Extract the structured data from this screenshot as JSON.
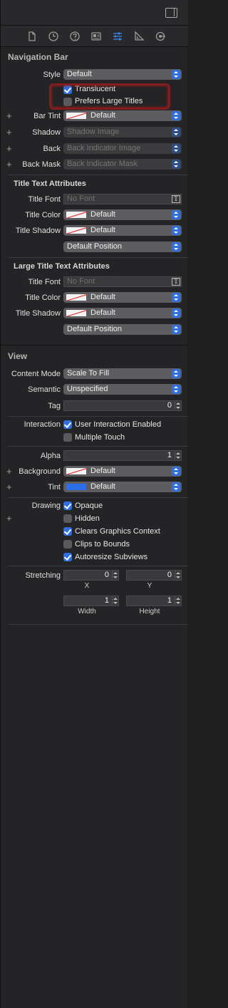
{
  "tabs": [
    {
      "name": "file-inspector-icon"
    },
    {
      "name": "history-inspector-icon"
    },
    {
      "name": "help-inspector-icon"
    },
    {
      "name": "identity-inspector-icon"
    },
    {
      "name": "attributes-inspector-icon",
      "active": true
    },
    {
      "name": "size-inspector-icon"
    },
    {
      "name": "connections-inspector-icon"
    }
  ],
  "nav_bar": {
    "title": "Navigation Bar",
    "style_label": "Style",
    "style_value": "Default",
    "translucent_label": "Translucent",
    "translucent_checked": true,
    "prefers_large_label": "Prefers Large Titles",
    "prefers_large_checked": false,
    "bar_tint_label": "Bar Tint",
    "bar_tint_value": "Default",
    "shadow_label": "Shadow",
    "shadow_placeholder": "Shadow Image",
    "back_label": "Back",
    "back_placeholder": "Back Indicator Image",
    "back_mask_label": "Back Mask",
    "back_mask_placeholder": "Back Indicator Mask"
  },
  "title_text": {
    "title": "Title Text Attributes",
    "font_label": "Title Font",
    "font_placeholder": "No Font",
    "color_label": "Title Color",
    "color_value": "Default",
    "shadow_label": "Title Shadow",
    "shadow_value": "Default",
    "position_value": "Default Position"
  },
  "large_title_text": {
    "title": "Large Title Text Attributes",
    "font_label": "Title Font",
    "font_placeholder": "No Font",
    "color_label": "Title Color",
    "color_value": "Default",
    "shadow_label": "Title Shadow",
    "shadow_value": "Default",
    "position_value": "Default Position"
  },
  "view": {
    "title": "View",
    "content_mode_label": "Content Mode",
    "content_mode_value": "Scale To Fill",
    "semantic_label": "Semantic",
    "semantic_value": "Unspecified",
    "tag_label": "Tag",
    "tag_value": "0",
    "interaction_label": "Interaction",
    "user_interaction_label": "User Interaction Enabled",
    "user_interaction_checked": true,
    "multiple_touch_label": "Multiple Touch",
    "multiple_touch_checked": false,
    "alpha_label": "Alpha",
    "alpha_value": "1",
    "background_label": "Background",
    "background_value": "Default",
    "tint_label": "Tint",
    "tint_value": "Default",
    "tint_color": "#2b6ee8",
    "drawing_label": "Drawing",
    "opaque_label": "Opaque",
    "opaque_checked": true,
    "hidden_label": "Hidden",
    "hidden_checked": false,
    "clears_label": "Clears Graphics Context",
    "clears_checked": true,
    "clips_label": "Clips to Bounds",
    "clips_checked": false,
    "autoresize_label": "Autoresize Subviews",
    "autoresize_checked": true,
    "stretching_label": "Stretching",
    "x_value": "0",
    "y_value": "0",
    "width_value": "1",
    "height_value": "1",
    "x_caption": "X",
    "y_caption": "Y",
    "width_caption": "Width",
    "height_caption": "Height"
  },
  "plus_symbol": "+",
  "font_button_glyph": "T",
  "colors": {
    "accent": "#2f6fe0",
    "highlight_stroke": "#8c1d1d"
  }
}
